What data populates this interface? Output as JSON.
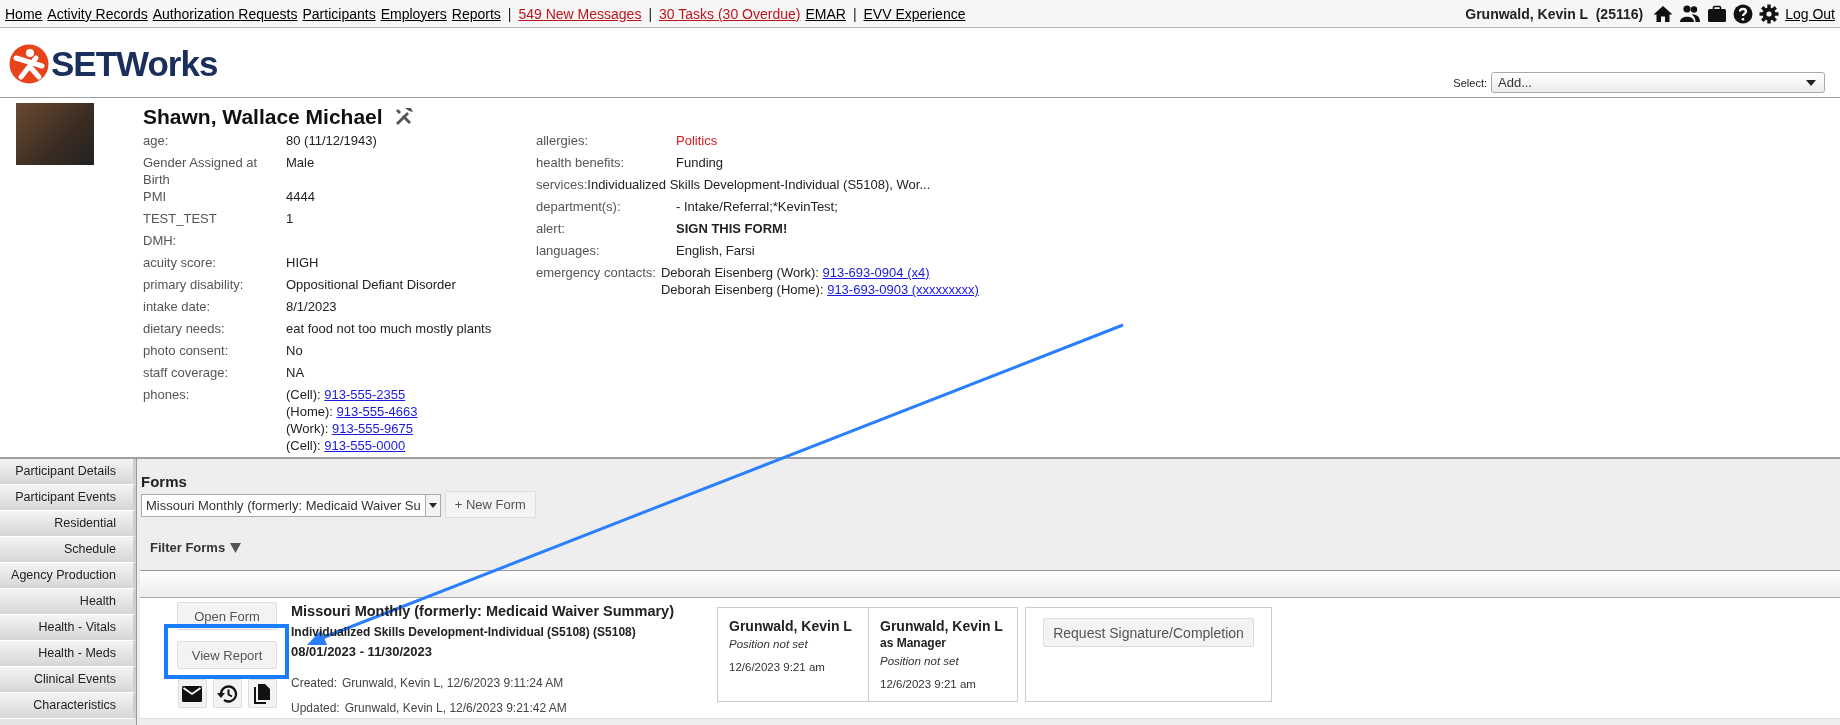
{
  "top_nav": {
    "items": [
      {
        "label": "Home",
        "kind": "link"
      },
      {
        "label": "Activity Records",
        "kind": "link"
      },
      {
        "label": "Authorization Requests",
        "kind": "link"
      },
      {
        "label": "Participants",
        "kind": "link"
      },
      {
        "label": "Employers",
        "kind": "link"
      },
      {
        "label": "Reports",
        "kind": "link"
      },
      {
        "label": "|",
        "kind": "separator"
      },
      {
        "label": "549 New Messages",
        "kind": "alert"
      },
      {
        "label": "|",
        "kind": "separator"
      },
      {
        "label": "30 Tasks (30 Overdue)",
        "kind": "alert"
      },
      {
        "label": "EMAR",
        "kind": "link"
      },
      {
        "label": "|",
        "kind": "separator"
      },
      {
        "label": "EVV Experience",
        "kind": "link"
      }
    ],
    "user": "Grunwald, Kevin L  (25116)",
    "logout": "Log Out"
  },
  "logo": {
    "text": "SETWorks"
  },
  "select": {
    "label": "Select:",
    "value": "Add..."
  },
  "participant": {
    "name": "Shawn, Wallace Michael",
    "left_fields": [
      {
        "label": "age:",
        "kind": "plain",
        "value": "80 (11/12/1943)"
      },
      {
        "label": "Gender Assigned at Birth",
        "kind": "plain",
        "value": "Male"
      },
      {
        "label": "PMI",
        "kind": "plain",
        "value": "4444"
      },
      {
        "label": "TEST_TEST",
        "kind": "plain",
        "value": "1"
      },
      {
        "label": "DMH:",
        "kind": "plain"
      },
      {
        "label": "acuity score:",
        "kind": "plain",
        "value": "HIGH"
      },
      {
        "label": "primary disability:",
        "kind": "plain",
        "value": "Oppositional Defiant Disorder"
      },
      {
        "label": "intake date:",
        "kind": "plain",
        "value": "8/1/2023"
      },
      {
        "label": "dietary needs:",
        "kind": "plain",
        "value": "eat food not too much mostly plants"
      },
      {
        "label": "photo consent:",
        "kind": "plain",
        "value": "No"
      },
      {
        "label": "staff coverage:",
        "kind": "plain",
        "value": "NA"
      },
      {
        "label": "phones:",
        "kind": "lines",
        "lines": [
          {
            "text": "(Cell):",
            "link": "913-555-2355"
          },
          {
            "text": "(Home):",
            "link": "913-555-4663"
          },
          {
            "text": "(Work):",
            "link": "913-555-9675"
          },
          {
            "text": "(Cell):",
            "link": "913-555-0000"
          }
        ]
      }
    ],
    "right_fields": [
      {
        "label": "allergies:",
        "kind": "warning",
        "value": "Politics"
      },
      {
        "label": "health benefits:",
        "kind": "plain",
        "value": "Funding"
      },
      {
        "label": "services:",
        "kind": "inline",
        "value": "Individualized Skills Development-Individual (S5108), Wor..."
      },
      {
        "label": "department(s):",
        "kind": "plain",
        "value": "- Intake/Referral;*KevinTest;"
      },
      {
        "label": "alert:",
        "kind": "bold",
        "value": "SIGN THIS FORM!"
      },
      {
        "label": "languages:",
        "kind": "plain",
        "value": "English, Farsi"
      },
      {
        "label": "emergency contacts:",
        "kind": "contacts",
        "lines": [
          {
            "text": "Deborah Eisenberg (Work):",
            "link": "913-693-0904 (x4)"
          },
          {
            "text": "Deborah Eisenberg (Home):",
            "link": "913-693-0903 (xxxxxxxxx)"
          }
        ]
      }
    ]
  },
  "sidebar": {
    "items": [
      {
        "label": "Participant Details",
        "selected": false
      },
      {
        "label": "Participant Events",
        "selected": false
      },
      {
        "label": "Residential",
        "selected": false
      },
      {
        "label": "Schedule",
        "selected": false
      },
      {
        "label": "Agency Production",
        "selected": false
      },
      {
        "label": "Health",
        "selected": false
      },
      {
        "label": "Health - Vitals",
        "selected": false
      },
      {
        "label": "Health - Meds",
        "selected": false
      },
      {
        "label": "Clinical Events",
        "selected": false
      },
      {
        "label": "Characteristics",
        "selected": false
      }
    ]
  },
  "forms": {
    "title": "Forms",
    "form_type": "Missouri Monthly (formerly: Medicaid Waiver Su",
    "new_form": "+ New Form",
    "filter": "Filter Forms",
    "entries": [
      {
        "buttons": [
          "Open Form",
          "View Report"
        ],
        "title": "Missouri Monthly (formerly: Medicaid Waiver Summary)",
        "service": "Individualized Skills Development-Individual (S5108) (S5108)",
        "period": "08/01/2023 - 11/30/2023",
        "created_label": "Created:",
        "created": "Grunwald, Kevin L, 12/6/2023 9:11:24 AM",
        "updated_label": "Updated:",
        "updated": "Grunwald, Kevin L, 12/6/2023 9:21:42 AM",
        "signatures": [
          {
            "name": "Grunwald, Kevin L",
            "position": "Position not set",
            "time": "12/6/2023 9:21 am"
          },
          {
            "name": "Grunwald, Kevin L",
            "role": "as Manager",
            "position": "Position not set",
            "time": "12/6/2023 9:21 am"
          }
        ],
        "request_button": "Request Signature/Completion"
      }
    ]
  }
}
